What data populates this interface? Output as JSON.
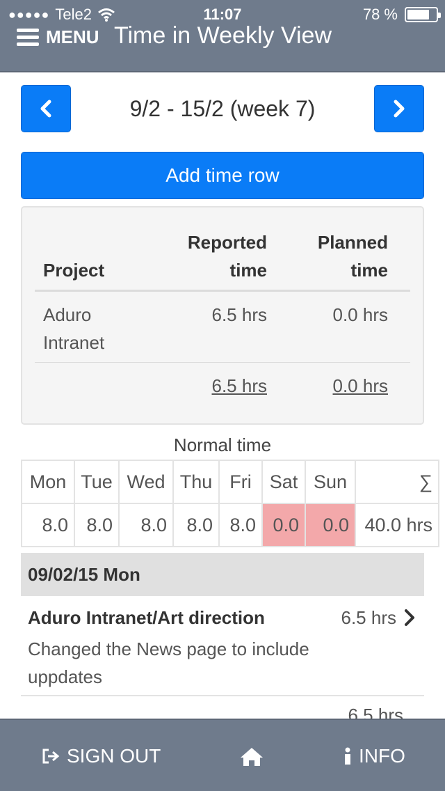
{
  "status_bar": {
    "carrier": "Tele2",
    "time": "11:07",
    "battery": "78 %",
    "battery_level": 0.78
  },
  "header": {
    "menu_label": "MENU",
    "title": "Time in Weekly View"
  },
  "week_nav": {
    "label": "9/2 - 15/2 (week 7)"
  },
  "add_row_label": "Add time row",
  "summary": {
    "headers": {
      "project": "Project",
      "reported_1": "Reported",
      "reported_2": "time",
      "planned_1": "Planned",
      "planned_2": "time"
    },
    "rows": [
      {
        "project_1": "Aduro",
        "project_2": "Intranet",
        "reported": "6.5 hrs",
        "planned": "0.0 hrs"
      }
    ],
    "totals": {
      "reported": "6.5 hrs",
      "planned": "0.0 hrs"
    }
  },
  "normal_time": {
    "label": "Normal time",
    "days": [
      "Mon",
      "Tue",
      "Wed",
      "Thu",
      "Fri",
      "Sat",
      "Sun"
    ],
    "sum_symbol": "∑",
    "values": [
      "8.0",
      "8.0",
      "8.0",
      "8.0",
      "8.0",
      "0.0",
      "0.0"
    ],
    "total": "40.0 hrs",
    "weekend_color": "#f3a8aa"
  },
  "day_group": {
    "label": "09/02/15 Mon"
  },
  "entries": [
    {
      "title": "Aduro Intranet/Art direction",
      "hours": "6.5 hrs",
      "desc_1": "Changed the News page to include",
      "desc_2": "uppdates"
    }
  ],
  "peek_entry_hours": "6.5 hrs",
  "footer": {
    "sign_out": "SIGN OUT",
    "info": "INFO"
  },
  "colors": {
    "header_bg": "#6f7b8c",
    "primary": "#0a7cf7"
  }
}
